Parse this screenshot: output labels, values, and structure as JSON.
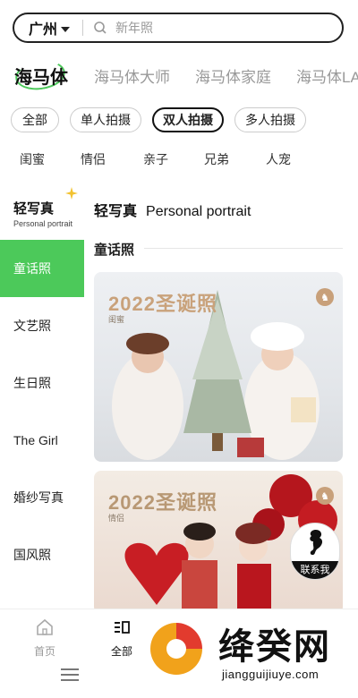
{
  "search": {
    "city": "广州",
    "placeholder": "新年照"
  },
  "brands": [
    {
      "label": "海马体"
    },
    {
      "label": "海马体大师"
    },
    {
      "label": "海马体家庭"
    },
    {
      "label": "海马体LA"
    }
  ],
  "chips": [
    {
      "label": "全部"
    },
    {
      "label": "单人拍摄"
    },
    {
      "label": "双人拍摄"
    },
    {
      "label": "多人拍摄"
    }
  ],
  "subtags": [
    {
      "label": "闺蜜"
    },
    {
      "label": "情侣"
    },
    {
      "label": "亲子"
    },
    {
      "label": "兄弟"
    },
    {
      "label": "人宠"
    }
  ],
  "sidebar": {
    "header_title": "轻写真",
    "header_subtitle": "Personal portrait",
    "items": [
      {
        "label": "童话照"
      },
      {
        "label": "文艺照"
      },
      {
        "label": "生日照"
      },
      {
        "label": "The Girl"
      },
      {
        "label": "婚纱写真"
      },
      {
        "label": "国风照"
      }
    ]
  },
  "content": {
    "title_cn": "轻写真",
    "title_en": "Personal portrait",
    "section_title": "童话照",
    "cards": [
      {
        "title": "2022圣诞照",
        "subtitle": "闺蜜"
      },
      {
        "title": "2022圣诞照",
        "subtitle": "情侣"
      }
    ]
  },
  "contact": {
    "label": "联系我"
  },
  "tabbar": {
    "home_label": "首页",
    "all_label": "全部"
  },
  "watermark": {
    "text": "绛癸网",
    "url": "jiangguijiuye.com"
  },
  "colors": {
    "accent": "#4cc95a"
  }
}
